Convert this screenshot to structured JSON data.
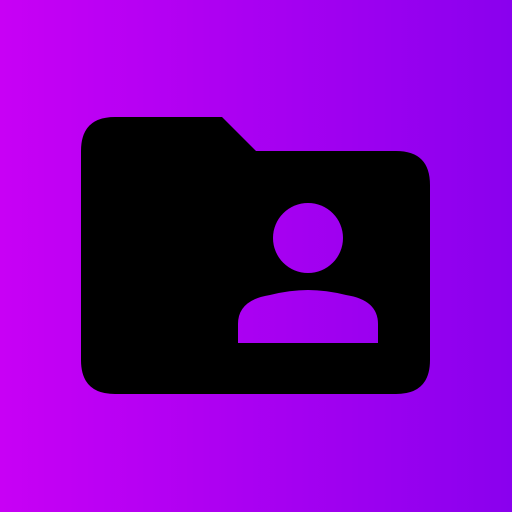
{
  "icon": {
    "name": "folder-shared-icon",
    "description_label": ""
  },
  "colors": {
    "background_start": "#c800f5",
    "background_end": "#8a00ee",
    "folder": "#000000"
  }
}
